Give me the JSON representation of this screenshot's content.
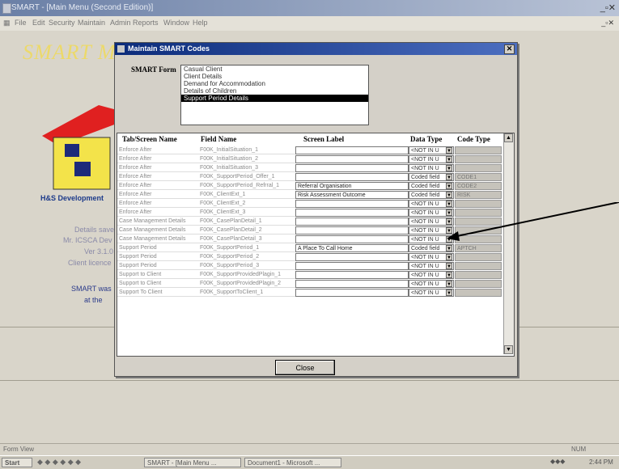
{
  "window": {
    "title": "SMART - [Main Menu (Second Edition)]",
    "menu": [
      "File",
      "Edit",
      "Security",
      "Maintain",
      "Admin",
      "Reports",
      "Window",
      "Help"
    ],
    "banner": "SMART MAIN",
    "bg_lines": [
      "H&S Development",
      "Details saved",
      "Mr. ICSCA Dev Id",
      "Ver 3.1.0",
      "Client licence",
      "SMART was",
      "at the"
    ]
  },
  "dialog": {
    "title": "Maintain SMART Codes",
    "form_label": "SMART Form",
    "forms": [
      "Casual Client",
      "Client Details",
      "Demand for Accommodation",
      "Details of Children",
      "Support Period Details"
    ],
    "selected_form_index": 4,
    "columns": [
      "Tab/Screen Name",
      "Field Name",
      "Screen Label",
      "Data Type",
      "Code Type"
    ],
    "rows": [
      {
        "tab": "Enforce After",
        "field": "F00K_InitialSituation_1",
        "label": "",
        "dtype": "<NOT IN U",
        "ctype": ""
      },
      {
        "tab": "Enforce After",
        "field": "F00K_InitialSituation_2",
        "label": "",
        "dtype": "<NOT IN U",
        "ctype": ""
      },
      {
        "tab": "Enforce After",
        "field": "F00K_InitialSituation_3",
        "label": "",
        "dtype": "<NOT IN U",
        "ctype": ""
      },
      {
        "tab": "Enforce After",
        "field": "F00K_SupportPeriod_Offer_1",
        "label": "",
        "dtype": "Coded field",
        "ctype": "CODE1"
      },
      {
        "tab": "Enforce After",
        "field": "F00K_SupportPeriod_Refrral_1",
        "label": "Referral Organisation",
        "dtype": "Coded field",
        "ctype": "CODE2"
      },
      {
        "tab": "Enforce After",
        "field": "F00K_ClientExt_1",
        "label": "Risk Assessment Outcome",
        "dtype": "Coded field",
        "ctype": "RISK"
      },
      {
        "tab": "Enforce After",
        "field": "F00K_ClientExt_2",
        "label": "",
        "dtype": "<NOT IN U",
        "ctype": ""
      },
      {
        "tab": "Enforce After",
        "field": "F00K_ClientExt_3",
        "label": "",
        "dtype": "<NOT IN U",
        "ctype": ""
      },
      {
        "tab": "Case Management Details",
        "field": "F00K_CasePlanDetail_1",
        "label": "",
        "dtype": "<NOT IN U",
        "ctype": ""
      },
      {
        "tab": "Case Management Details",
        "field": "F00K_CasePlanDetail_2",
        "label": "",
        "dtype": "<NOT IN U",
        "ctype": ""
      },
      {
        "tab": "Case Management Details",
        "field": "F00K_CasePlanDetail_3",
        "label": "",
        "dtype": "<NOT IN U",
        "ctype": ""
      },
      {
        "tab": "Support Period",
        "field": "F00K_SupportPeriod_1",
        "label": "A Place To Call Home",
        "dtype": "Coded field",
        "ctype": "APTCH"
      },
      {
        "tab": "Support Period",
        "field": "F00K_SupportPeriod_2",
        "label": "",
        "dtype": "<NOT IN U",
        "ctype": ""
      },
      {
        "tab": "Support Period",
        "field": "F00K_SupportPeriod_3",
        "label": "",
        "dtype": "<NOT IN U",
        "ctype": ""
      },
      {
        "tab": "Support to Client",
        "field": "F00K_SupportProvidedPlagin_1",
        "label": "",
        "dtype": "<NOT IN U",
        "ctype": ""
      },
      {
        "tab": "Support to Client",
        "field": "F00K_SupportProvidedPlagin_2",
        "label": "",
        "dtype": "<NOT IN U",
        "ctype": ""
      },
      {
        "tab": "Support To Client",
        "field": "F00K_SupportToClient_1",
        "label": "",
        "dtype": "<NOT IN U",
        "ctype": ""
      }
    ],
    "close_label": "Close"
  },
  "statusbar": {
    "text": "Form View",
    "num": "NUM"
  },
  "taskbar": {
    "start": "Start",
    "tasks": [
      "SMART - [Main Menu ...",
      "Document1 - Microsoft ..."
    ],
    "clock": "2:44 PM"
  }
}
